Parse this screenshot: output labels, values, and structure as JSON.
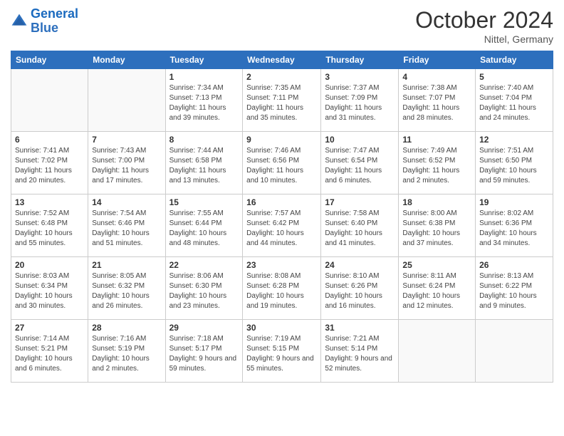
{
  "logo": {
    "line1": "General",
    "line2": "Blue"
  },
  "header": {
    "month": "October 2024",
    "location": "Nittel, Germany"
  },
  "weekdays": [
    "Sunday",
    "Monday",
    "Tuesday",
    "Wednesday",
    "Thursday",
    "Friday",
    "Saturday"
  ],
  "weeks": [
    [
      {
        "day": "",
        "info": ""
      },
      {
        "day": "",
        "info": ""
      },
      {
        "day": "1",
        "info": "Sunrise: 7:34 AM\nSunset: 7:13 PM\nDaylight: 11 hours and 39 minutes."
      },
      {
        "day": "2",
        "info": "Sunrise: 7:35 AM\nSunset: 7:11 PM\nDaylight: 11 hours and 35 minutes."
      },
      {
        "day": "3",
        "info": "Sunrise: 7:37 AM\nSunset: 7:09 PM\nDaylight: 11 hours and 31 minutes."
      },
      {
        "day": "4",
        "info": "Sunrise: 7:38 AM\nSunset: 7:07 PM\nDaylight: 11 hours and 28 minutes."
      },
      {
        "day": "5",
        "info": "Sunrise: 7:40 AM\nSunset: 7:04 PM\nDaylight: 11 hours and 24 minutes."
      }
    ],
    [
      {
        "day": "6",
        "info": "Sunrise: 7:41 AM\nSunset: 7:02 PM\nDaylight: 11 hours and 20 minutes."
      },
      {
        "day": "7",
        "info": "Sunrise: 7:43 AM\nSunset: 7:00 PM\nDaylight: 11 hours and 17 minutes."
      },
      {
        "day": "8",
        "info": "Sunrise: 7:44 AM\nSunset: 6:58 PM\nDaylight: 11 hours and 13 minutes."
      },
      {
        "day": "9",
        "info": "Sunrise: 7:46 AM\nSunset: 6:56 PM\nDaylight: 11 hours and 10 minutes."
      },
      {
        "day": "10",
        "info": "Sunrise: 7:47 AM\nSunset: 6:54 PM\nDaylight: 11 hours and 6 minutes."
      },
      {
        "day": "11",
        "info": "Sunrise: 7:49 AM\nSunset: 6:52 PM\nDaylight: 11 hours and 2 minutes."
      },
      {
        "day": "12",
        "info": "Sunrise: 7:51 AM\nSunset: 6:50 PM\nDaylight: 10 hours and 59 minutes."
      }
    ],
    [
      {
        "day": "13",
        "info": "Sunrise: 7:52 AM\nSunset: 6:48 PM\nDaylight: 10 hours and 55 minutes."
      },
      {
        "day": "14",
        "info": "Sunrise: 7:54 AM\nSunset: 6:46 PM\nDaylight: 10 hours and 51 minutes."
      },
      {
        "day": "15",
        "info": "Sunrise: 7:55 AM\nSunset: 6:44 PM\nDaylight: 10 hours and 48 minutes."
      },
      {
        "day": "16",
        "info": "Sunrise: 7:57 AM\nSunset: 6:42 PM\nDaylight: 10 hours and 44 minutes."
      },
      {
        "day": "17",
        "info": "Sunrise: 7:58 AM\nSunset: 6:40 PM\nDaylight: 10 hours and 41 minutes."
      },
      {
        "day": "18",
        "info": "Sunrise: 8:00 AM\nSunset: 6:38 PM\nDaylight: 10 hours and 37 minutes."
      },
      {
        "day": "19",
        "info": "Sunrise: 8:02 AM\nSunset: 6:36 PM\nDaylight: 10 hours and 34 minutes."
      }
    ],
    [
      {
        "day": "20",
        "info": "Sunrise: 8:03 AM\nSunset: 6:34 PM\nDaylight: 10 hours and 30 minutes."
      },
      {
        "day": "21",
        "info": "Sunrise: 8:05 AM\nSunset: 6:32 PM\nDaylight: 10 hours and 26 minutes."
      },
      {
        "day": "22",
        "info": "Sunrise: 8:06 AM\nSunset: 6:30 PM\nDaylight: 10 hours and 23 minutes."
      },
      {
        "day": "23",
        "info": "Sunrise: 8:08 AM\nSunset: 6:28 PM\nDaylight: 10 hours and 19 minutes."
      },
      {
        "day": "24",
        "info": "Sunrise: 8:10 AM\nSunset: 6:26 PM\nDaylight: 10 hours and 16 minutes."
      },
      {
        "day": "25",
        "info": "Sunrise: 8:11 AM\nSunset: 6:24 PM\nDaylight: 10 hours and 12 minutes."
      },
      {
        "day": "26",
        "info": "Sunrise: 8:13 AM\nSunset: 6:22 PM\nDaylight: 10 hours and 9 minutes."
      }
    ],
    [
      {
        "day": "27",
        "info": "Sunrise: 7:14 AM\nSunset: 5:21 PM\nDaylight: 10 hours and 6 minutes."
      },
      {
        "day": "28",
        "info": "Sunrise: 7:16 AM\nSunset: 5:19 PM\nDaylight: 10 hours and 2 minutes."
      },
      {
        "day": "29",
        "info": "Sunrise: 7:18 AM\nSunset: 5:17 PM\nDaylight: 9 hours and 59 minutes."
      },
      {
        "day": "30",
        "info": "Sunrise: 7:19 AM\nSunset: 5:15 PM\nDaylight: 9 hours and 55 minutes."
      },
      {
        "day": "31",
        "info": "Sunrise: 7:21 AM\nSunset: 5:14 PM\nDaylight: 9 hours and 52 minutes."
      },
      {
        "day": "",
        "info": ""
      },
      {
        "day": "",
        "info": ""
      }
    ]
  ]
}
